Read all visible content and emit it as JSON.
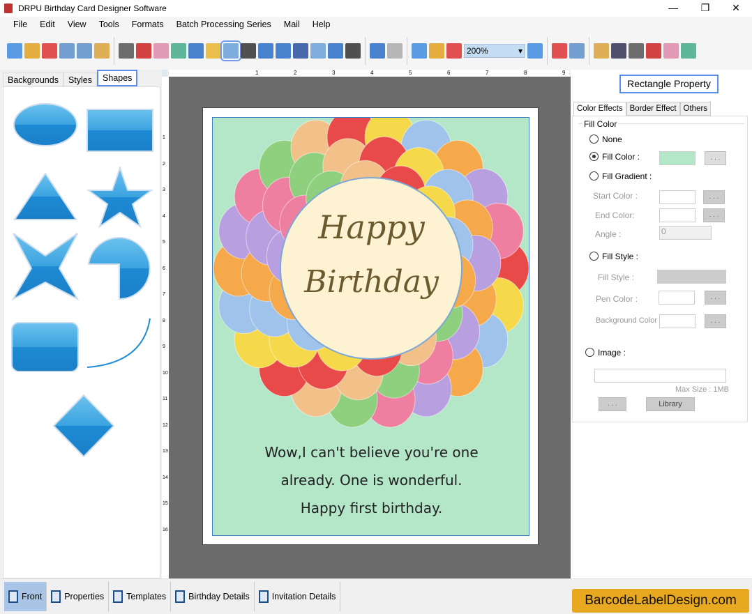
{
  "window": {
    "title": "DRPU Birthday Card Designer Software",
    "minimize": "—",
    "maximize": "❐",
    "close": "✕"
  },
  "menu": [
    "File",
    "Edit",
    "View",
    "Tools",
    "Formats",
    "Batch Processing Series",
    "Mail",
    "Help"
  ],
  "toolbar": {
    "icons": [
      "new-icon",
      "open-icon",
      "close-file-icon",
      "save-icon",
      "save-as-icon",
      "export-icon",
      "|",
      "properties-icon",
      "print-icon",
      "print-multi-icon",
      "gift-icon",
      "add-image-icon",
      "pen-icon",
      "shapes-icon",
      "wordart-icon",
      "barcode-icon",
      "text-icon",
      "text-doc-icon",
      "signature-icon",
      "mail-icon",
      "line-icon",
      "|",
      "database-icon",
      "database2-icon",
      "|",
      "redo-icon",
      "undo-icon",
      "zoom-in-icon"
    ],
    "zoom": "200%",
    "icons2": [
      "zoom-out-icon",
      "|",
      "lock-icon",
      "unlock-icon",
      "|",
      "arrow-left-icon",
      "flip-icon",
      "arrow-right-icon",
      "arrow-up-icon",
      "align-icon",
      "arrow-down-icon"
    ]
  },
  "left_tabs": [
    "Backgrounds",
    "Styles",
    "Shapes"
  ],
  "ruler_top": [
    "1",
    "2",
    "3",
    "4",
    "5",
    "6",
    "7",
    "8",
    "9"
  ],
  "ruler_left": [
    "1",
    "2",
    "3",
    "4",
    "5",
    "6",
    "7",
    "8",
    "9",
    "10",
    "11",
    "12",
    "13",
    "14",
    "15",
    "16"
  ],
  "card": {
    "title1": "Happy",
    "title2": "Birthday",
    "lines": [
      "Wow,I can't believe you're one",
      "already. One is wonderful.",
      "Happy first birthday."
    ],
    "fill": "#b4e6c8"
  },
  "right": {
    "title": "Rectangle Property",
    "tabs": [
      "Color Effects",
      "Border Effect",
      "Others"
    ],
    "group": "Fill Color",
    "none": "None",
    "fill_color": "Fill Color :",
    "fill_gradient": "Fill Gradient :",
    "start_color": "Start Color :",
    "end_color": "End Color:",
    "angle": "Angle :",
    "angle_value": "0",
    "fill_style": "Fill Style :",
    "fill_style_label": "Fill Style :",
    "pen_color": "Pen Color :",
    "bg_color": "Background Color :",
    "image": "Image :",
    "max_size": "Max Size : 1MB",
    "dots": ". . .",
    "library": "Library",
    "selected": "fill_color",
    "fill_swatch": "#b4e6c8"
  },
  "bottom_tabs": [
    "Front",
    "Properties",
    "Templates",
    "Birthday Details",
    "Invitation Details"
  ],
  "brand": "BarcodeLabelDesign.com"
}
